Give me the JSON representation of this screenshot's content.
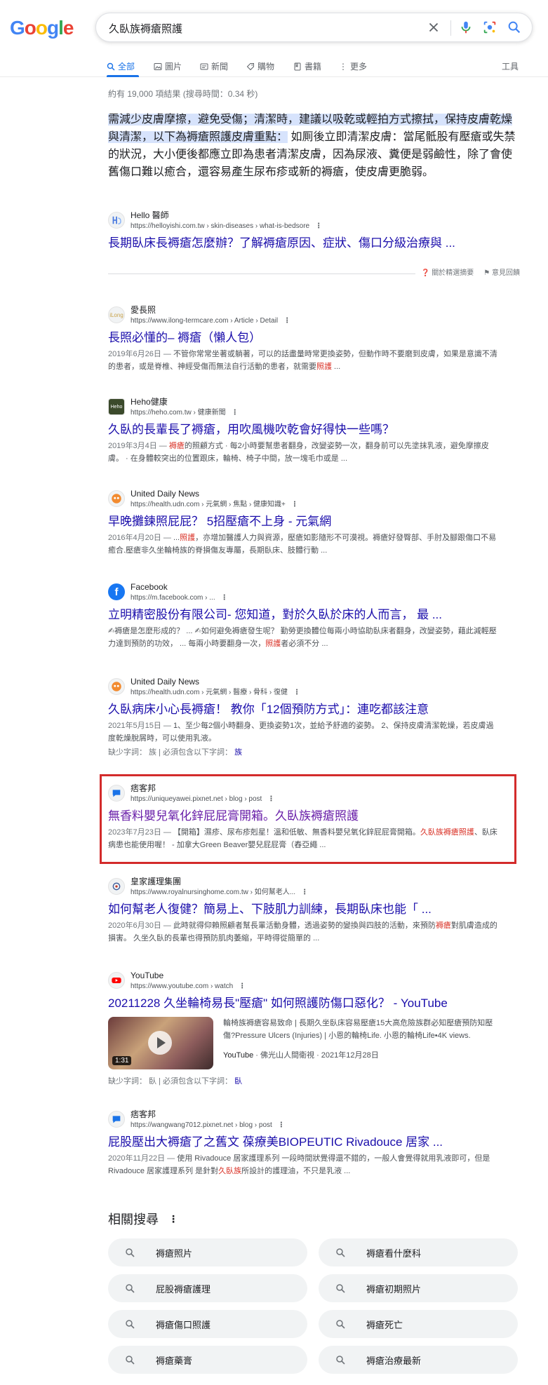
{
  "logo": "Google",
  "search": {
    "query": "久臥族褥瘡照護"
  },
  "tabs": [
    {
      "label": "全部"
    },
    {
      "label": "圖片"
    },
    {
      "label": "新聞"
    },
    {
      "label": "購物"
    },
    {
      "label": "書籍"
    },
    {
      "label": "更多"
    }
  ],
  "tools_label": "工具",
  "stats": "約有 19,000 項結果 (搜尋時間：0.34 秒)",
  "snippet": {
    "highlight": "需減少皮膚摩擦，避免受傷；清潔時，建議以吸乾或輕拍方式擦拭，保持皮膚乾燥與清潔，以下為褥瘡照護皮膚重點：",
    "rest": " 如厠後立即清潔皮膚：當尾骶股有壓瘡或失禁的狀況，大小便後都應立即為患者清潔皮膚，因為尿液、糞便是弱鹼性，除了會使舊傷口難以癒合，還容易產生尿布疹或新的褥瘡，使皮膚更脆弱。",
    "site": "Hello 醫師",
    "url": "https://helloyishi.com.tw › skin-diseases › what-is-bedsore",
    "title": "長期臥床長褥瘡怎麼辦？了解褥瘡原因、症狀、傷口分級治療與 ...",
    "about": "關於精選摘要",
    "feedback": "意見回饋"
  },
  "results": [
    {
      "site": "愛長照",
      "url": "https://www.ilong-termcare.com › Article › Detail",
      "title": "長照必懂的– 褥瘡（懶人包）",
      "date": "2019年6月26日 — ",
      "snip_a": "不管你常常坐著或躺著，可以的話盡量時常更換姿勢，但動作時不要磨到皮膚，如果是意識不清的患者，或是脊椎、神經受傷而無法自行活動的患者，就需要",
      "em": "照護",
      "snip_b": " ..."
    },
    {
      "site": "Heho健康",
      "url": "https://heho.com.tw › 健康新聞",
      "title": "久臥的長輩長了褥瘡，用吹風機吹乾會好得快一些嗎？",
      "date": "2019年3月4日 — ",
      "em": "褥瘡",
      "snip_a": "",
      "snip_b": "的照顧方式 · 每2小時要幫患者翻身，改變姿勢一次，翻身前可以先塗抹乳液，避免摩擦皮膚。 · 在身體較突出的位置跟床，輪椅、椅子中間，放一塊毛巾或是 ..."
    },
    {
      "site": "United Daily News",
      "url": "https://health.udn.com › 元氣網 › 焦點 › 健康知識+",
      "title": "早晚攤鍊照屁屁？ 5招壓瘡不上身 - 元氣網",
      "date": "2016年4月20日 — ",
      "snip_a": "...",
      "em": "照護",
      "snip_b": "，亦增加醫護人力與資源，壓瘡如影隨形不可漠視。褥瘡好發臀部、手肘及腳跟傷口不易癒合.壓瘡非久坐輪椅族的脊損傷友專屬，長期臥床、肢體行動 ..."
    },
    {
      "site": "Facebook",
      "url": "https://m.facebook.com › ...",
      "title": "立明精密股份有限公司- 您知道，對於久臥於床的人而言， 最 ...",
      "date": "",
      "snip_a": "✍褥瘡是怎麼形成的？ ... ✍如何避免褥瘡發生呢？ 勤勞更換體位每兩小時協助臥床者翻身，改變姿勢，藉此減輕壓力達到預防的功效， ... 每兩小時要翻身一次，",
      "em": "照護",
      "snip_b": "者必須不分 ..."
    },
    {
      "site": "United Daily News",
      "url": "https://health.udn.com › 元氣網 › 醫療 › 骨科 › 復健",
      "title": "久臥病床小心長褥瘡！ 教你「12個預防方式」：連吃都該注意",
      "date": "2021年5月15日 — ",
      "snip_a": "1、至少每2個小時翻身、更換姿勢1次，並給予舒適的姿勢。 2、保持皮膚清潔乾燥，若皮膚過度乾燥脫屑時，可以使用乳液。",
      "em": "",
      "snip_b": "",
      "missing": "缺少字詞： 族 | 必須包含以下字詞：",
      "missing_link": "族"
    },
    {
      "site": "痞客邦",
      "url": "https://uniqueyawei.pixnet.net › blog › post",
      "title": "無香料嬰兒氧化鋅屁屁膏開箱。久臥族褥瘡照護",
      "date": "2023年7月23日 — ",
      "snip_a": "【開箱】濕疹、尿布疹剋星！溫和低敏、無香料嬰兒氧化鋅屁屁膏開箱。",
      "em": "久臥族褥瘡照護",
      "snip_b": "、臥床病患也能使用喔！ - 加拿大Green Beaver嬰兒屁屁膏（舂亞繩 ..."
    },
    {
      "site": "皇家護理集團",
      "url": "https://www.royalnursinghome.com.tw › 如何幫老人...",
      "title": "如何幫老人復健？簡易上、下肢肌力訓練，長期臥床也能「 ...",
      "date": "2020年6月30日 — ",
      "snip_a": "此時就得仰賴照顧者幫長輩活動身體，透過姿勢的變換與四肢的活動，來預防",
      "em": "褥瘡",
      "snip_b": "對肌膚造成的損害。 久坐久臥的長輩也得預防肌肉萎縮，平時得從簡單的 ..."
    }
  ],
  "video": {
    "site": "YouTube",
    "url": "https://www.youtube.com › watch",
    "title": "20211228 久坐輪椅易長\"壓瘡\" 如何照護防傷口惡化？ - YouTube",
    "duration": "1:31",
    "desc": "輪椅族褥瘡容易致命 | 長期久坐臥床容易壓瘡15大高危險族群必知壓瘡預防知壓傷?Pressure Ulcers (Injuries) | 小恩的輪椅Life. 小恩的輪椅Life•4K views.",
    "source": "YouTube",
    "meta": " · 佛光山人間衛視 · 2021年12月28日",
    "missing": "缺少字詞： 臥 | 必須包含以下字詞：",
    "missing_link": "臥"
  },
  "last_result": {
    "site": "痞客邦",
    "url": "https://wangwang7012.pixnet.net › blog › post",
    "title": "屁股壓出大褥瘡了之舊文 葆療美BIOPEUTIC Rivadouce 居家 ...",
    "date": "2020年11月22日 — ",
    "snip_a": "使用 Rivadouce 居家護理系列 一段時間狀覺得還不錯的，一般人會覺得就用乳液即可，但是 Rivadouce 居家護理系列 是針對",
    "em": "久臥族",
    "snip_b": "所設計的護理油，不只是乳液 ..."
  },
  "related": {
    "title": "相關搜尋",
    "items": [
      "褥瘡照片",
      "褥瘡看什麼科",
      "屁股褥瘡護理",
      "褥瘡初期照片",
      "褥瘡傷口照護",
      "褥瘡死亡",
      "褥瘡藥膏",
      "褥瘡治療最新"
    ]
  }
}
